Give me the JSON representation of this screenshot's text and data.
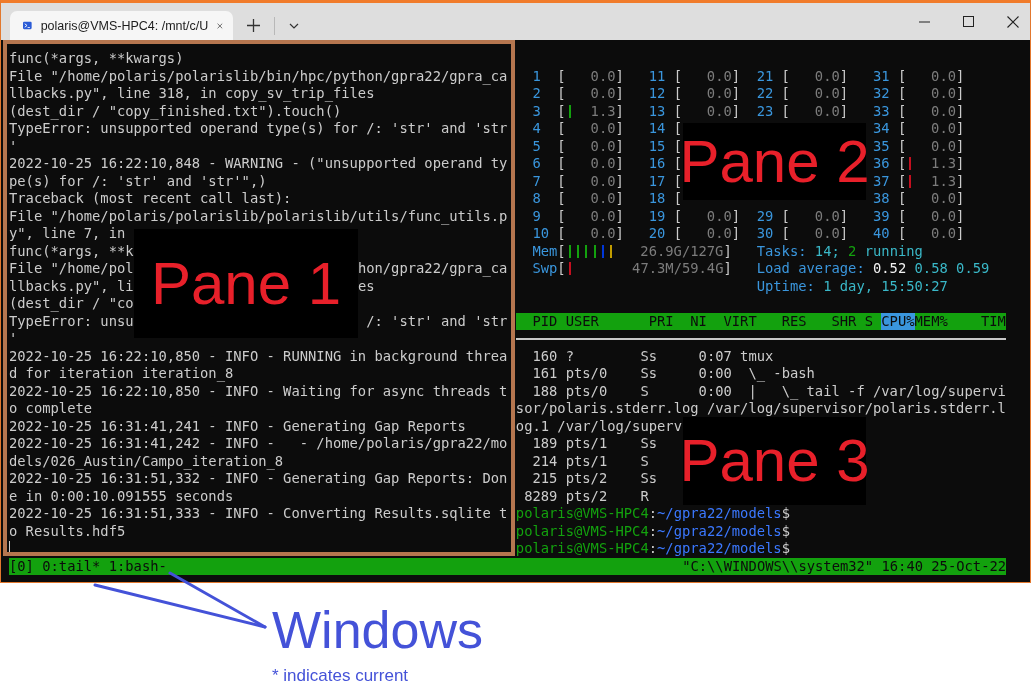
{
  "window": {
    "tab_title": "polaris@VMS-HPC4: /mnt/c/U"
  },
  "pane_1": {
    "lines": [
      {
        "text": "func(*args, **kwargs)"
      },
      {
        "text": "File \"/home/polaris/polarislib/bin/hpc/python/gpra22/gpra_ca"
      },
      {
        "text": "llbacks.py\", line 318, in copy_sv_trip_files"
      },
      {
        "text": "(dest_dir / \"copy_finished.txt\").touch()"
      },
      {
        "text": "TypeError: unsupported operand type(s) for /: 'str' and 'str"
      },
      {
        "text": "'"
      },
      {
        "text": "2022-10-25 16:22:10,848 - WARNING - (\"unsupported operand ty"
      },
      {
        "text": "pe(s) for /: 'str' and 'str'\",)"
      },
      {
        "text": "Traceback (most recent call last):"
      },
      {
        "text": "File \"/home/polaris/polarislib/polarislib/utils/func_utils.p"
      },
      {
        "left": "y\", line 7, in"
      },
      {
        "left": "func(*args, **k"
      },
      {
        "left": "File \"/home/pol",
        "right": "hon/gpra22/gpra_ca"
      },
      {
        "left": "llbacks.py\", li",
        "right": "es"
      },
      {
        "left": "(dest_dir / \"co"
      },
      {
        "left": "TypeError: unsu",
        "right": " /: 'str' and 'str"
      },
      {
        "text": "'"
      },
      {
        "text": "2022-10-25 16:22:10,850 - INFO - RUNNING in background threa"
      },
      {
        "text": "d for iteration iteration_8"
      },
      {
        "text": "2022-10-25 16:22:10,850 - INFO - Waiting for async threads t"
      },
      {
        "text": "o complete"
      },
      {
        "text": "2022-10-25 16:31:41,241 - INFO - Generating Gap Reports"
      },
      {
        "text": "2022-10-25 16:31:41,242 - INFO -   - /home/polaris/gpra22/mo"
      },
      {
        "text": "dels/026_Austin/Campo_iteration_8"
      },
      {
        "text": "2022-10-25 16:31:51,332 - INFO - Generating Gap Reports: Don"
      },
      {
        "text": "e in 0:00:10.091555 seconds"
      },
      {
        "text": "2022-10-25 16:31:51,333 - INFO - Converting Results.sqlite t"
      },
      {
        "text": "o Results.hdf5"
      }
    ]
  },
  "pane_2": {
    "cpu_rows": [
      {
        "cells": [
          {
            "label": "1",
            "open": "[",
            "value": "0.0",
            "close": "]"
          },
          {
            "label": "11",
            "open": "[",
            "value": "0.0",
            "close": "]"
          },
          {
            "label": "21",
            "open": "[",
            "value": "0.0",
            "close": "]"
          },
          {
            "label": "31",
            "open": "[",
            "value": "0.0",
            "close": "]"
          }
        ]
      },
      {
        "cells": [
          {
            "label": "2",
            "open": "[",
            "value": "0.0",
            "close": "]"
          },
          {
            "label": "12",
            "open": "[",
            "value": "0.0",
            "close": "]"
          },
          {
            "label": "22",
            "open": "[",
            "value": "0.0",
            "close": "]"
          },
          {
            "label": "32",
            "open": "[",
            "value": "0.0",
            "close": "]"
          }
        ]
      },
      {
        "cells": [
          {
            "label": "3",
            "open": "[",
            "color": "#13a10e",
            "value": "1.3",
            "close": "]"
          },
          {
            "label": "13",
            "open": "[",
            "value": "0.0",
            "close": "]"
          },
          {
            "label": "23",
            "open": "[",
            "value": "0.0",
            "close": "]"
          },
          {
            "label": "33",
            "open": "[",
            "value": "0.0",
            "close": "]"
          }
        ]
      },
      {
        "left": [
          {
            "label": "4",
            "open": "[",
            "value": "0.0",
            "close": "]"
          },
          {
            "label": "14",
            "open": "["
          }
        ],
        "right": [
          {
            "label": "34",
            "open": "[",
            "value": "0.0",
            "close": "]"
          }
        ]
      },
      {
        "left": [
          {
            "label": "5",
            "open": "[",
            "value": "0.0",
            "close": "]"
          },
          {
            "label": "15",
            "open": "["
          }
        ],
        "right": [
          {
            "label": "35",
            "open": "[",
            "value": "0.0",
            "close": "]"
          }
        ]
      },
      {
        "left": [
          {
            "label": "6",
            "open": "[",
            "value": "0.0",
            "close": "]"
          },
          {
            "label": "16",
            "open": "["
          }
        ],
        "right": [
          {
            "label": "36",
            "open": "[",
            "color": "#c50f1f",
            "value": "1.3",
            "close": "]"
          }
        ]
      },
      {
        "left": [
          {
            "label": "7",
            "open": "[",
            "value": "0.0",
            "close": "]"
          },
          {
            "label": "17",
            "open": "["
          }
        ],
        "right": [
          {
            "label": "37",
            "open": "[",
            "color": "#c50f1f",
            "value": "1.3",
            "close": "]"
          }
        ]
      },
      {
        "left": [
          {
            "label": "8",
            "open": "[",
            "value": "0.0",
            "close": "]"
          },
          {
            "label": "18",
            "open": "["
          }
        ],
        "right": [
          {
            "label": "38",
            "open": "[",
            "value": "0.0",
            "close": "]"
          }
        ]
      },
      {
        "cells": [
          {
            "label": "9",
            "open": "[",
            "value": "0.0",
            "close": "]"
          },
          {
            "label": "19",
            "open": "[",
            "value": "0.0",
            "close": "]"
          },
          {
            "label": "29",
            "open": "[",
            "value": "0.0",
            "close": "]"
          },
          {
            "label": "39",
            "open": "[",
            "value": "0.0",
            "close": "]"
          }
        ]
      },
      {
        "cells": [
          {
            "label": "10",
            "open": "[",
            "value": "0.0",
            "close": "]"
          },
          {
            "label": "20",
            "open": "[",
            "value": "0.0",
            "close": "]"
          },
          {
            "label": "30",
            "open": "[",
            "value": "0.0",
            "close": "]"
          },
          {
            "label": "40",
            "open": "[",
            "value": "0.0",
            "close": "]"
          }
        ]
      }
    ],
    "memory": {
      "label": "Mem",
      "open": "[",
      "bars": [
        {
          "color": "#13a10e"
        },
        {
          "color": "#13a10e"
        },
        {
          "color": "#13a10e"
        },
        {
          "color": "#13a10e"
        },
        {
          "color": "#0037da"
        },
        {
          "color": "#c19c00"
        }
      ],
      "value": "26.9G/127G",
      "close": "]"
    },
    "swap": {
      "label": "Swp",
      "open": "[",
      "bars": [
        {
          "color": "#c50f1f"
        }
      ],
      "value": "47.3M/59.4G",
      "close": "]"
    },
    "tasks": [
      {
        "text": "Tasks: ",
        "kind": "label"
      },
      {
        "text": "14",
        "kind": "value"
      },
      {
        "text": "; ",
        "kind": "value"
      },
      {
        "text": "2",
        "kind": "running"
      },
      {
        "text": " running",
        "kind": "value"
      }
    ],
    "load_average": [
      {
        "text": "Load average: ",
        "kind": "label"
      },
      {
        "text": "0.52",
        "kind": "bright"
      },
      {
        "text": " 0.58 0.59",
        "kind": "value"
      }
    ],
    "uptime": [
      {
        "text": "Uptime: ",
        "kind": "label"
      },
      {
        "text": "1 day, 15:50:27",
        "kind": "value"
      }
    ],
    "header": [
      {
        "text": "  PID USER      PRI  NI  VIRT   RES   SHR S ",
        "selected": false
      },
      {
        "text": "CPU%",
        "selected": true
      },
      {
        "text": "MEM%    TIM",
        "selected": false
      }
    ]
  },
  "pane_3": {
    "lines": [
      {
        "text": "  160 ?        Ss     0:07 tmux"
      },
      {
        "text": "  161 pts/0    Ss     0:00  \\_ -bash"
      },
      {
        "text": "  188 pts/0    S      0:00  |   \\_ tail -f /var/log/supervi"
      },
      {
        "text": "sor/polaris.stderr.log /var/log/supervisor/polaris.stderr.l"
      },
      {
        "left": "og.1 /var/log/superv"
      },
      {
        "left": "  189 pts/1    Ss"
      },
      {
        "left": "  214 pts/1    S"
      },
      {
        "left": "  215 pts/2    Ss"
      },
      {
        "left": " 8289 pts/2    R"
      }
    ],
    "prompts": [
      {
        "user": "polaris@VMS-HPC4",
        "separator": ":",
        "path": "~/gpra22/models",
        "symbol": "$"
      },
      {
        "user": "polaris@VMS-HPC4",
        "separator": ":",
        "path": "~/gpra22/models",
        "symbol": "$"
      },
      {
        "user": "polaris@VMS-HPC4",
        "separator": ":",
        "path": "~/gpra22/models",
        "symbol": "$"
      }
    ]
  },
  "status_bar": {
    "windows": "[0] 0:tail* 1:bash-",
    "info": "\"C:\\\\WINDOWS\\\\system32\" 16:40 25-Oct-22"
  },
  "annotations": {
    "pane_labels": [
      "Pane 1",
      "Pane 2",
      "Pane 3"
    ],
    "title": "Windows",
    "note": "* indicates current"
  }
}
